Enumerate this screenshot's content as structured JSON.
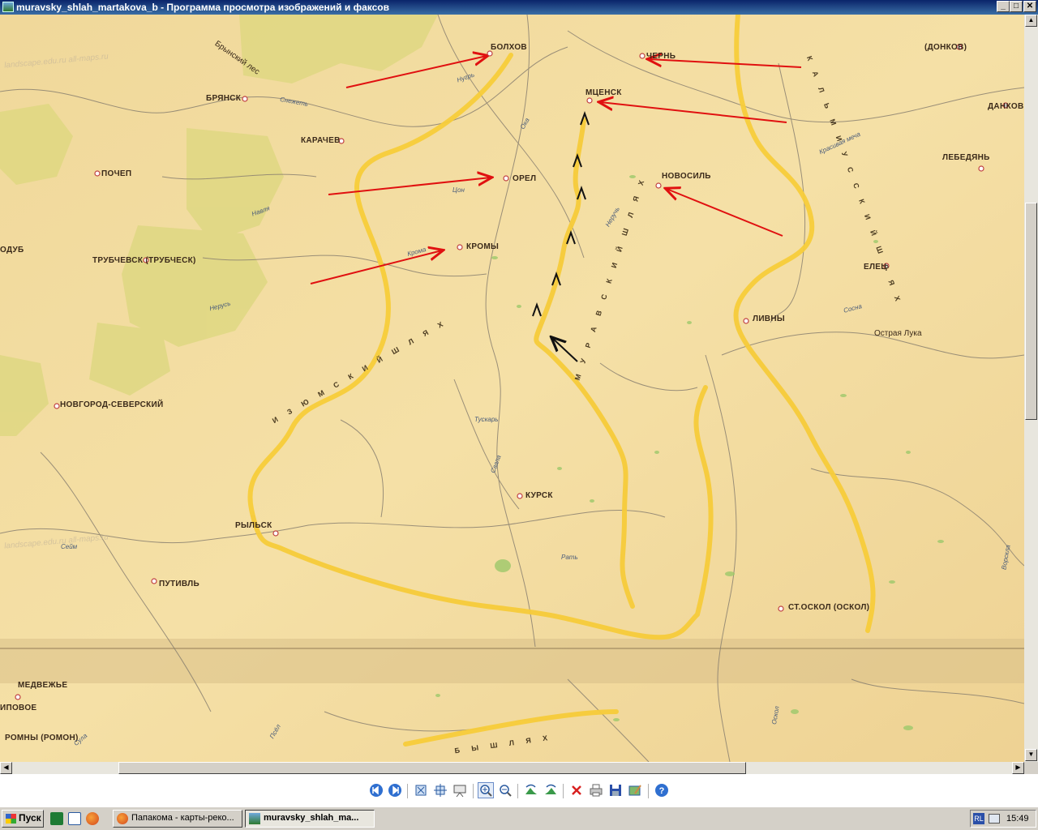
{
  "window": {
    "title": "muravsky_shlah_martakova_b - Программа просмотра изображений и факсов",
    "min_label": "_",
    "max_label": "□",
    "close_label": "✕"
  },
  "map": {
    "cities": [
      "БОЛХОВ",
      "ЧЕРНЬ",
      "МЦЕНСК",
      "БРЯНСК",
      "КАРАЧЕВ",
      "ПОЧЕП",
      "ОРЕЛ",
      "НОВОСИЛЬ",
      "ТРУБЧЕВСК (ТРУБЧЕСК)",
      "КРОМЫ",
      "ДАНКОВ",
      "ЛЕБЕДЯНЬ",
      "ЕЛЕЦ",
      "ЛИВНЫ",
      "НОВГОРОД-СЕВЕРСКИЙ",
      "КУРСК",
      "РЫЛЬСК",
      "ПУТИВЛЬ",
      "СТ.ОСКОЛ (ОСКОЛ)",
      "МЕДВЕЖЬЕ",
      "РОМНЫ (РОМОН)",
      "(ДОНКОВ)",
      "ОДУБ",
      "ИПОВОЕ"
    ],
    "rivers": [
      "Нугрь",
      "Ока",
      "Неручь",
      "Красивая меча",
      "Сосна",
      "Сейм",
      "Нерусь",
      "Навля",
      "Крома",
      "Свапа",
      "Тускарь",
      "Оскол",
      "Ворскла",
      "Псёл",
      "Сула",
      "Рать",
      "Снежеть",
      "Цон"
    ],
    "labels": [
      "Брынский лес",
      "Острая Лука"
    ],
    "route_names": [
      "М У Р А В С К И Й   Ш Л Я Х",
      "И З Ю М С К И Й   Ш Л Я Х",
      "К А Л Ь М И У С С К И Й   Ш Л Я Х",
      "Б Ы Ш Л Я Х"
    ],
    "watermark": "landscape.edu.ru all-maps.ru",
    "colors": {
      "paper": "#f3dc9c",
      "forest": "#dcd77e",
      "route": "#f7cc3a",
      "red_arrow": "#e01010",
      "black_arrow": "#111111"
    }
  },
  "toolbar_icons": [
    "previous-image-icon",
    "next-image-icon",
    "best-fit-icon",
    "actual-size-icon",
    "slideshow-icon",
    "zoom-in-icon",
    "zoom-out-icon",
    "rotate-clockwise-icon",
    "rotate-counterclockwise-icon",
    "delete-icon",
    "print-icon",
    "save-icon",
    "edit-icon",
    "help-icon"
  ],
  "taskbar": {
    "start_label": "Пуск",
    "tasks": [
      {
        "label": "Папакома - карты-реко...",
        "icon": "firefox-icon"
      },
      {
        "label": "muravsky_shlah_ma...",
        "icon": "image-viewer-icon"
      }
    ],
    "tray_lang": "RL",
    "clock": "15:49"
  }
}
